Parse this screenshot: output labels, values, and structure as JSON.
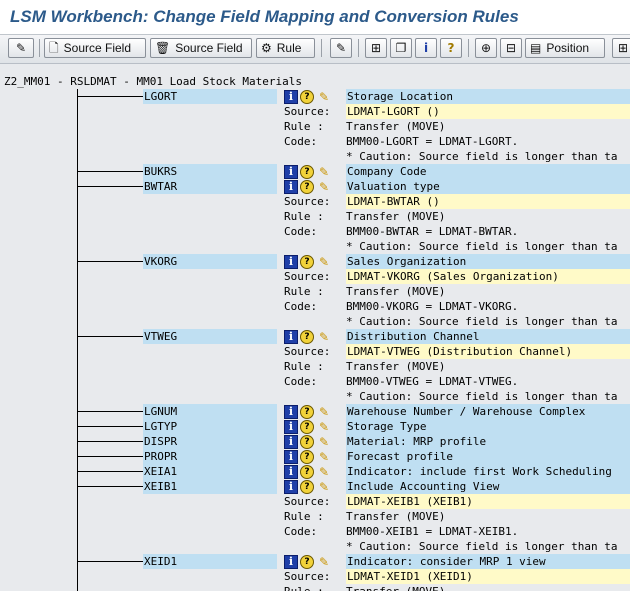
{
  "window": {
    "title": "LSM Workbench: Change Field Mapping and Conversion Rules"
  },
  "toolbar": {
    "source_field_label": "Source Field",
    "source_field_delete_label": "Source Field",
    "rule_label": "Rule",
    "position_label": "Position"
  },
  "tree": {
    "root": "Z2_MM01 - RSLDMAT - MM01 Load Stock Materials",
    "labels": {
      "source": "Source:",
      "rule": "Rule :",
      "code": "Code:"
    },
    "fields": [
      {
        "name": "LGORT",
        "description": "Storage Location",
        "source": "LDMAT-LGORT ()",
        "rule": "Transfer (MOVE)",
        "code": "BMM00-LGORT = LDMAT-LGORT.",
        "caution": "* Caution: Source field is longer than ta"
      },
      {
        "name": "BUKRS",
        "description": "Company Code"
      },
      {
        "name": "BWTAR",
        "description": "Valuation type",
        "source": "LDMAT-BWTAR ()",
        "rule": "Transfer (MOVE)",
        "code": "BMM00-BWTAR = LDMAT-BWTAR.",
        "caution": "* Caution: Source field is longer than ta"
      },
      {
        "name": "VKORG",
        "description": "Sales Organization",
        "source": "LDMAT-VKORG (Sales Organization)",
        "rule": "Transfer (MOVE)",
        "code": "BMM00-VKORG = LDMAT-VKORG.",
        "caution": "* Caution: Source field is longer than ta"
      },
      {
        "name": "VTWEG",
        "description": "Distribution Channel",
        "source": "LDMAT-VTWEG (Distribution Channel)",
        "rule": "Transfer (MOVE)",
        "code": "BMM00-VTWEG = LDMAT-VTWEG.",
        "caution": "* Caution: Source field is longer than ta"
      },
      {
        "name": "LGNUM",
        "description": "Warehouse Number / Warehouse Complex"
      },
      {
        "name": "LGTYP",
        "description": "Storage Type"
      },
      {
        "name": "DISPR",
        "description": "Material: MRP profile"
      },
      {
        "name": "PROPR",
        "description": "Forecast profile"
      },
      {
        "name": "XEIA1",
        "description": "Indicator: include first Work Scheduling"
      },
      {
        "name": "XEIB1",
        "description": "Include Accounting View",
        "source": "LDMAT-XEIB1 (XEIB1)",
        "rule": "Transfer (MOVE)",
        "code": "BMM00-XEIB1 = LDMAT-XEIB1.",
        "caution": "* Caution: Source field is longer than ta"
      },
      {
        "name": "XEID1",
        "description": "Indicator: consider MRP 1 view",
        "source": "LDMAT-XEID1 (XEID1)",
        "rule": "Transfer (MOVE)"
      }
    ]
  }
}
